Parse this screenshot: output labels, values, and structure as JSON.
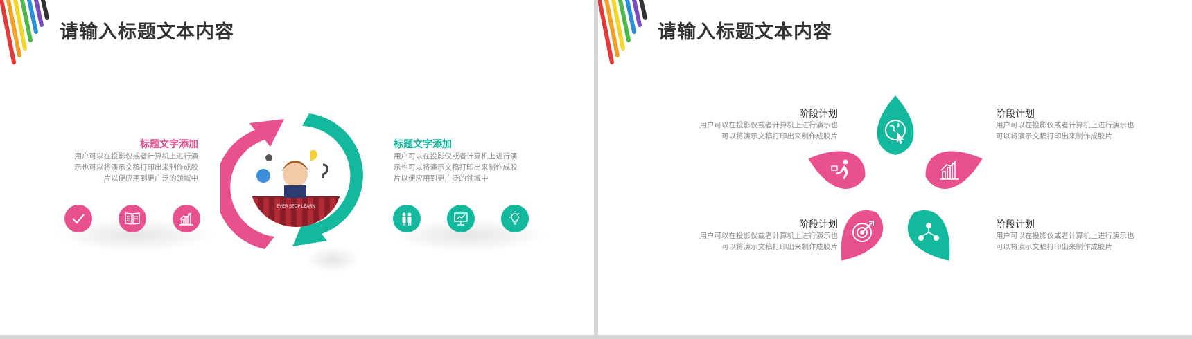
{
  "slide1": {
    "title": "请输入标题文本内容",
    "left": {
      "heading": "标题文字添加",
      "lines": [
        "用户可以在投影仪或者计算机上进行演",
        "示也可以将演示文稿打印出来制作成胶",
        "片以便应用到更广泛的领域中"
      ],
      "icons": [
        "check-icon",
        "book-icon",
        "bar-chart-icon"
      ]
    },
    "right": {
      "heading": "标题文字添加",
      "lines": [
        "用户可以在投影仪或者计算机上进行演",
        "示也可以将演示文稿打印出来制作成胶",
        "片以便应用到更广泛的领域中"
      ],
      "icons": [
        "people-icon",
        "presentation-icon",
        "lightbulb-icon"
      ]
    },
    "photo_text": "EVER  STOP  LEARN"
  },
  "slide2": {
    "title": "请输入标题文本内容",
    "stages": [
      {
        "title": "阶段计划",
        "lines": [
          "用户可以在投影仪或者计算机上进行演示也",
          "可以将演示文稿打印出来制作成胶片"
        ]
      },
      {
        "title": "阶段计划",
        "lines": [
          "用户可以在投影仪或者计算机上进行演示也",
          "可以将演示文稿打印出来制作成胶片"
        ]
      },
      {
        "title": "阶段计划",
        "lines": [
          "用户可以在投影仪或者计算机上进行演示也",
          "可以将演示文稿打印出来制作成胶片"
        ]
      },
      {
        "title": "阶段计划",
        "lines": [
          "用户可以在投影仪或者计算机上进行演示也",
          "可以将演示文稿打印出来制作成胶片"
        ]
      }
    ],
    "petal_icons": [
      "globe-cursor-icon",
      "growth-chart-icon",
      "network-icon",
      "target-icon",
      "runner-icon"
    ]
  },
  "colors": {
    "pink": "#e9508e",
    "teal": "#14b89c",
    "title": "#333333",
    "text": "#8a8a8a"
  }
}
